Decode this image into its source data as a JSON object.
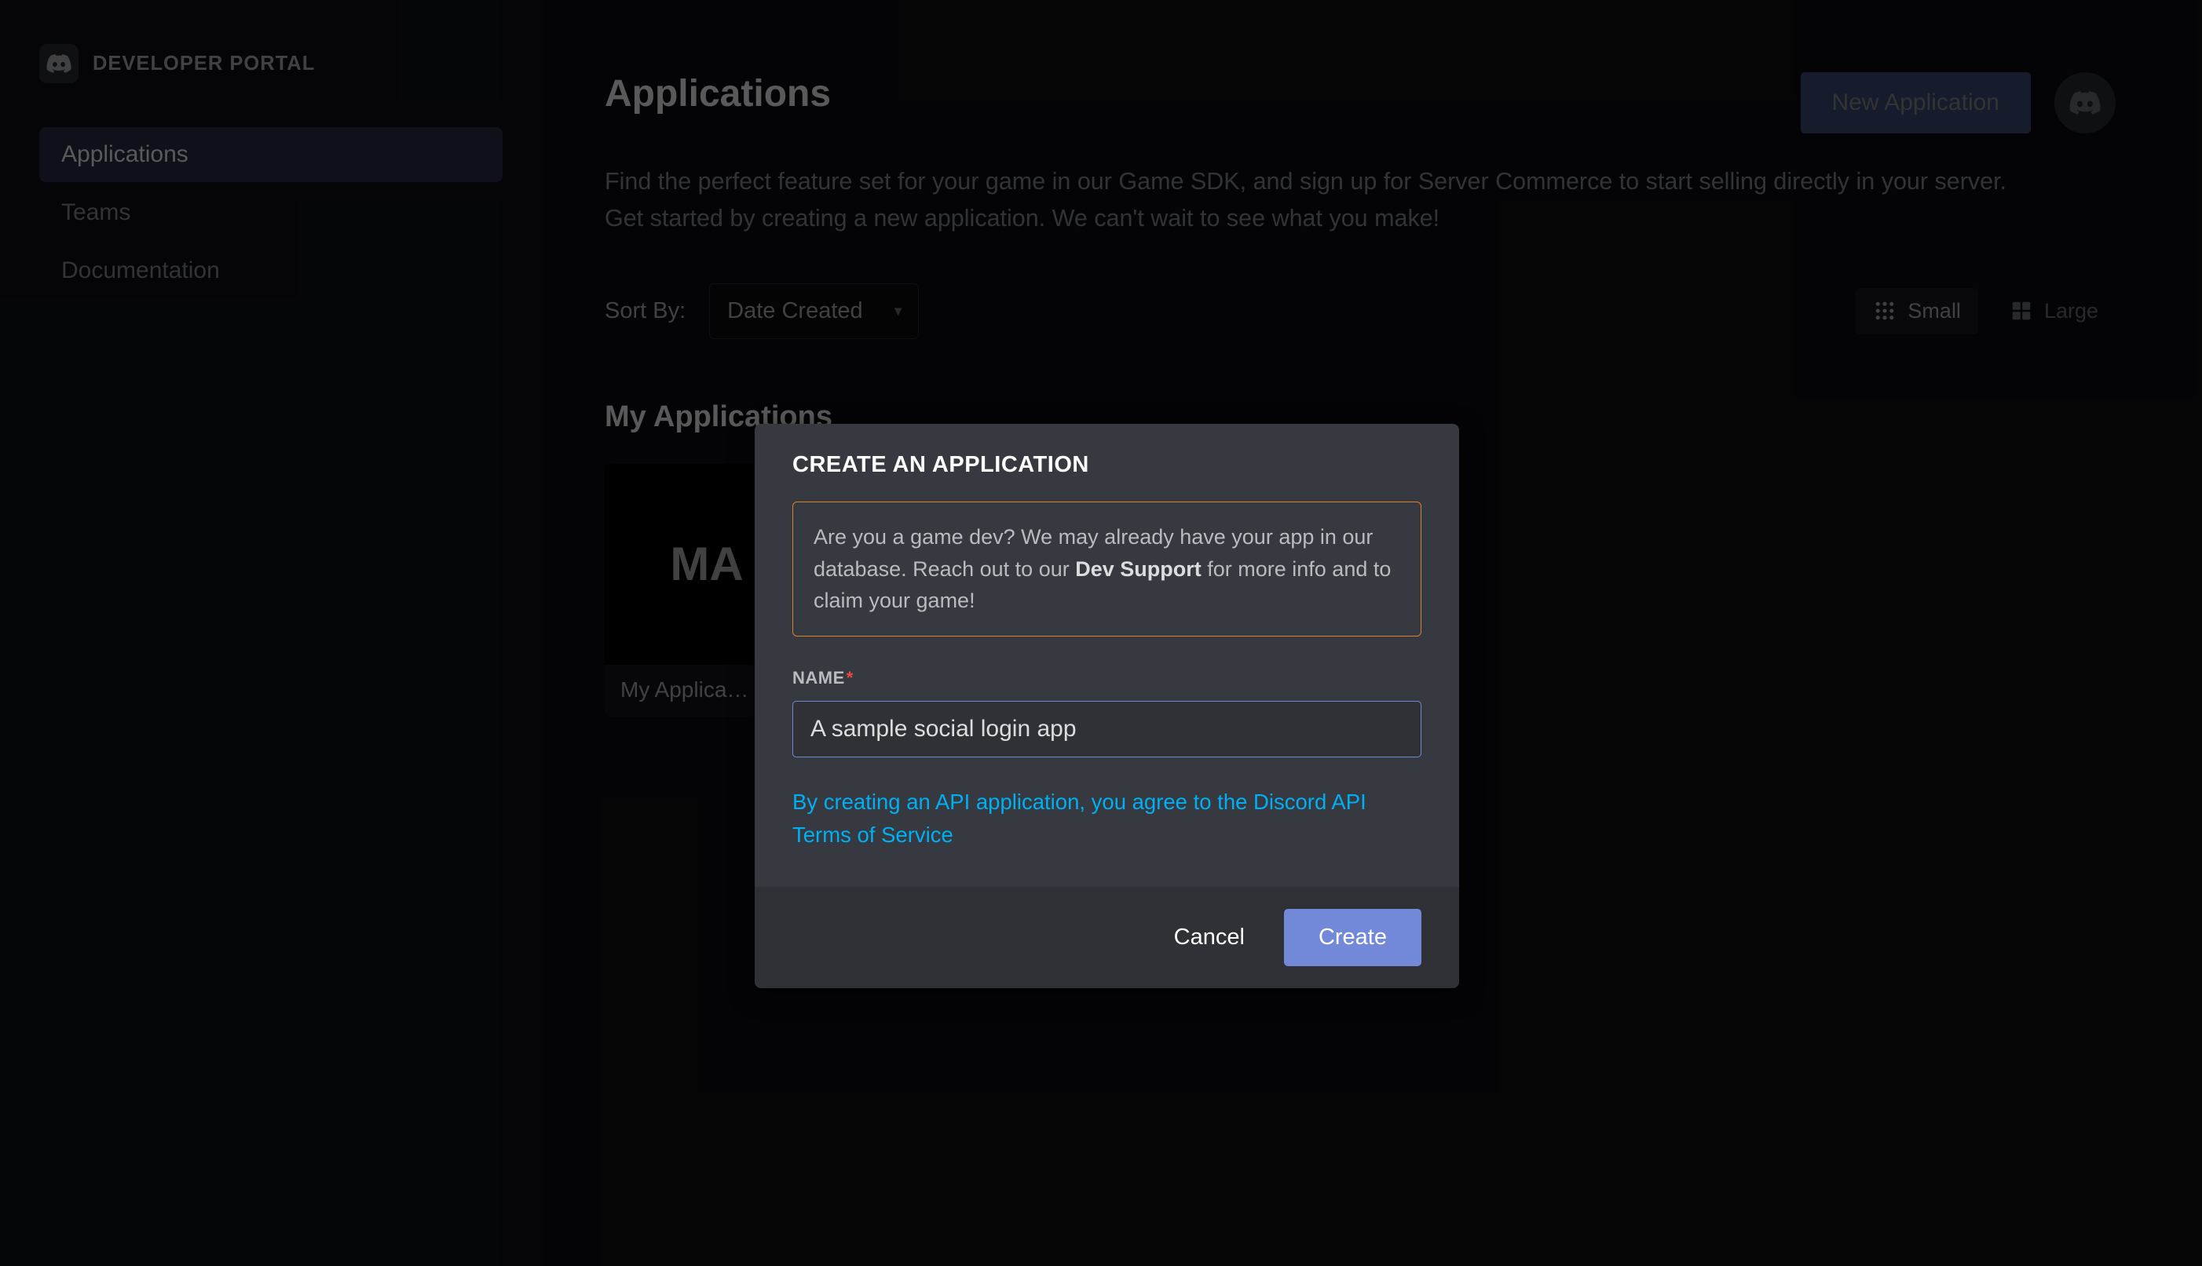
{
  "sidebar": {
    "brand": "DEVELOPER PORTAL",
    "items": [
      {
        "label": "Applications",
        "active": true
      },
      {
        "label": "Teams",
        "active": false
      },
      {
        "label": "Documentation",
        "active": false
      }
    ]
  },
  "page": {
    "title": "Applications",
    "description": "Find the perfect feature set for your game in our Game SDK, and sign up for Server Commerce to start selling directly in your server. Get started by creating a new application. We can't wait to see what you make!",
    "new_app_button": "New Application",
    "sort_label": "Sort By:",
    "sort_value": "Date Created",
    "view_small": "Small",
    "view_large": "Large",
    "section_title": "My Applications",
    "apps": [
      {
        "thumb_label": "MA",
        "name": "My Applica…"
      }
    ]
  },
  "modal": {
    "title": "CREATE AN APPLICATION",
    "notice_pre": "Are you a game dev? We may already have your app in our database. Reach out to our ",
    "notice_bold": "Dev Support",
    "notice_post": " for more info and to claim your game!",
    "name_label": "NAME",
    "name_value": "A sample social login app",
    "tos_text": "By creating an API application, you agree to the Discord API Terms of Service",
    "cancel": "Cancel",
    "create": "Create"
  }
}
